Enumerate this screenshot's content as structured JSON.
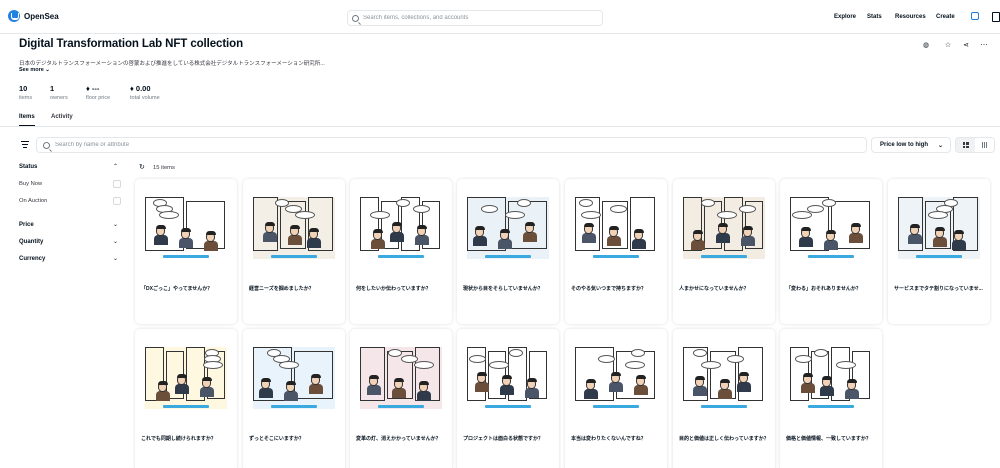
{
  "nav": {
    "logo_text": "OpenSea",
    "search_placeholder": "Search items, collections, and accounts",
    "links": [
      "Explore",
      "Stats",
      "Resources",
      "Create"
    ],
    "icons": [
      "wallet-icon",
      "cart-icon"
    ]
  },
  "collection": {
    "title": "Digital Transformation Lab NFT collection",
    "description": "日本のデジタルトランスフォーメーションの啓蒙および推進をしている株式会社デジタルトランスフォーメーション研究所...",
    "see_more": "See more",
    "actions": [
      "globe-icon",
      "star-icon",
      "share-icon",
      "more-icon"
    ],
    "stats": [
      {
        "value": "10",
        "label": "items"
      },
      {
        "value": "1",
        "label": "owners"
      },
      {
        "value": "♦ ---",
        "label": "floor price"
      },
      {
        "value": "♦ 0.00",
        "label": "total volume"
      }
    ]
  },
  "tabs": [
    {
      "label": "Items",
      "active": true
    },
    {
      "label": "Activity",
      "active": false
    }
  ],
  "filter": {
    "search_placeholder": "Search by name or attribute",
    "sort_label": "Price low to high"
  },
  "sidebar": {
    "status_label": "Status",
    "status_options": [
      "Buy Now",
      "On Auction"
    ],
    "sections": [
      "Price",
      "Quantity",
      "Currency"
    ]
  },
  "results": {
    "count_label": "15 items"
  },
  "items": [
    {
      "name": "「DXごっこ」やってませんか？",
      "bg": "#ffffff"
    },
    {
      "name": "経営ニーズを掴めましたか？",
      "bg": "#f4efe6"
    },
    {
      "name": "何をしたいか伝わっていますか？",
      "bg": "#ffffff"
    },
    {
      "name": "現状から目をそらしていませんか？",
      "bg": "#eaf2f8"
    },
    {
      "name": "そのやる気いつまで持ちますか？",
      "bg": "#ffffff"
    },
    {
      "name": "人まかせになっていませんか？",
      "bg": "#f3ece3"
    },
    {
      "name": "「変わる」おそれありませんか？",
      "bg": "#ffffff"
    },
    {
      "name": "サービスまでタテ割りになっていませ...",
      "bg": "#eef3f8"
    },
    {
      "name": "これでも同期し続けられますか？",
      "bg": "#fff8e1"
    },
    {
      "name": "ずっとそこにいますか？",
      "bg": "#e9f3fb"
    },
    {
      "name": "変革の灯、消えかかっていませんか？",
      "bg": "#f5e6ea"
    },
    {
      "name": "プロジェクトは面白る状態ですか？",
      "bg": "#ffffff"
    },
    {
      "name": "本当は変わりたくないんですね？",
      "bg": "#ffffff"
    },
    {
      "name": "目的と価値は正しく伝わっていますか？",
      "bg": "#ffffff"
    },
    {
      "name": "価格と価値情報、一致していますか？",
      "bg": "#ffffff"
    }
  ]
}
